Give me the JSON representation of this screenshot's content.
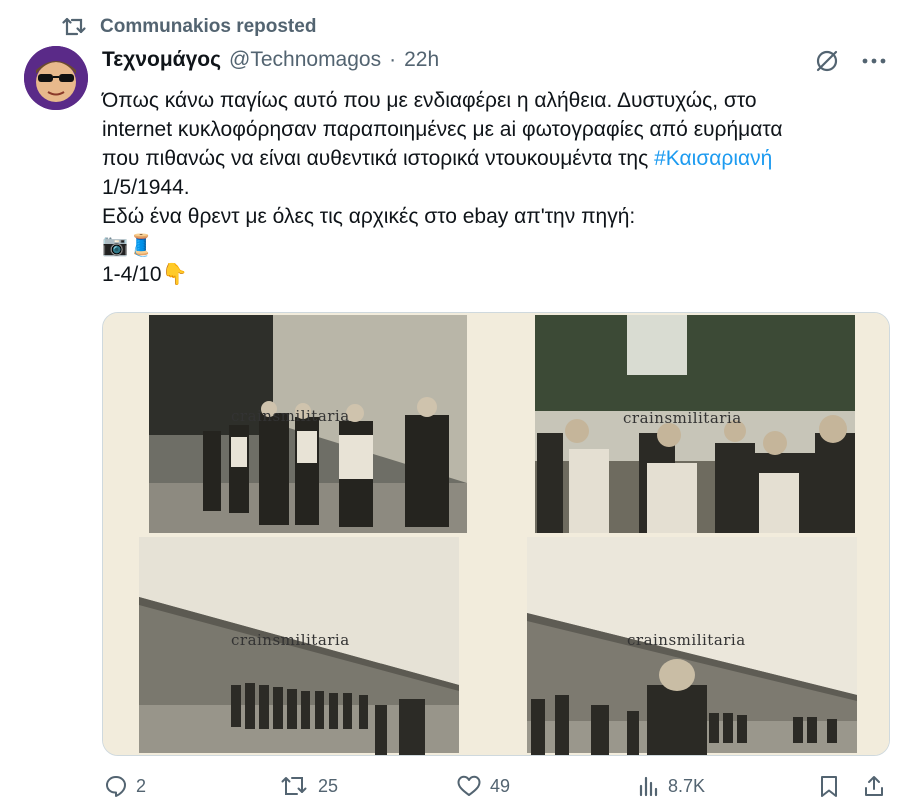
{
  "repost": {
    "text": "Communakios reposted",
    "icon": "repost-icon"
  },
  "author": {
    "display_name": "Τεχνομάγος",
    "handle": "@Technomagos",
    "separator": "·",
    "time": "22h",
    "avatar": "avatar"
  },
  "body": {
    "line1": "Όπως κάνω παγίως αυτό που με ενδιαφέρει η αλήθεια. Δυστυχώς, στο",
    "line2": "internet κυκλοφόρησαν παραποιημένες με ai φωτογραφίες από ευρήματα",
    "line3_prefix": "που πιθανώς να είναι αυθεντικά ιστορικά ντουκουμέντα της ",
    "hashtag": "#Καισαριανή",
    "line4": "1/5/1944.",
    "line5": "Εδώ ένα θρεντ με όλες τις αρχικές στο ebay απ'την πηγή:",
    "emoji_line": "📷🧵",
    "counter": "1-4/10",
    "counter_emoji": "👇"
  },
  "media": {
    "watermarks": [
      "crainsmilitaria",
      "crainsmilitaria",
      "crainsmilitaria",
      "crainsmilitaria"
    ]
  },
  "actions": {
    "replies": "2",
    "reposts": "25",
    "likes": "49",
    "views": "8.7K"
  },
  "colors": {
    "accent": "#1d9bf0",
    "muted": "#536471",
    "text": "#0f1419"
  }
}
